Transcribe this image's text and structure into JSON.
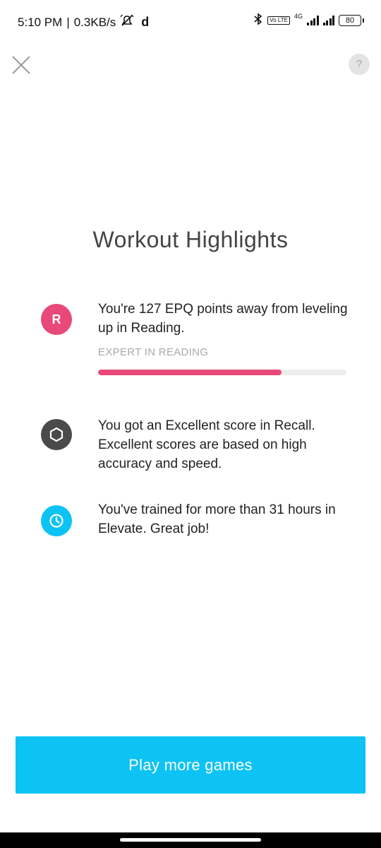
{
  "status_bar": {
    "time": "5:10 PM",
    "separator": "|",
    "speed": "0.3KB/s",
    "app_letter": "d",
    "net_type": "4G",
    "volte": "Vo LTE",
    "battery": "80",
    "icons": [
      "muted-alarm-icon",
      "bluetooth-icon",
      "volte-icon",
      "signal-icon",
      "signal-icon",
      "battery-icon"
    ]
  },
  "header": {
    "close_icon": "close-icon",
    "help_label": "?"
  },
  "page": {
    "title": "Workout Highlights"
  },
  "highlights": [
    {
      "icon_label": "R",
      "icon_color": "#e8497a",
      "text": "You're 127 EPQ points away from leveling up in Reading.",
      "sublabel": "EXPERT IN READING",
      "progress_fraction": 0.74,
      "progress_color": "#e8497a"
    },
    {
      "icon": "hexagon-icon",
      "icon_color": "#4a4a4a",
      "text": "You got an Excellent score in Recall. Excellent scores are based on high accuracy and speed."
    },
    {
      "icon": "clock-icon",
      "icon_color": "#0dc3f4",
      "text": "You've trained for more than 31 hours in Elevate. Great job!"
    }
  ],
  "cta": {
    "label": "Play more games",
    "color": "#0dc3f4"
  }
}
